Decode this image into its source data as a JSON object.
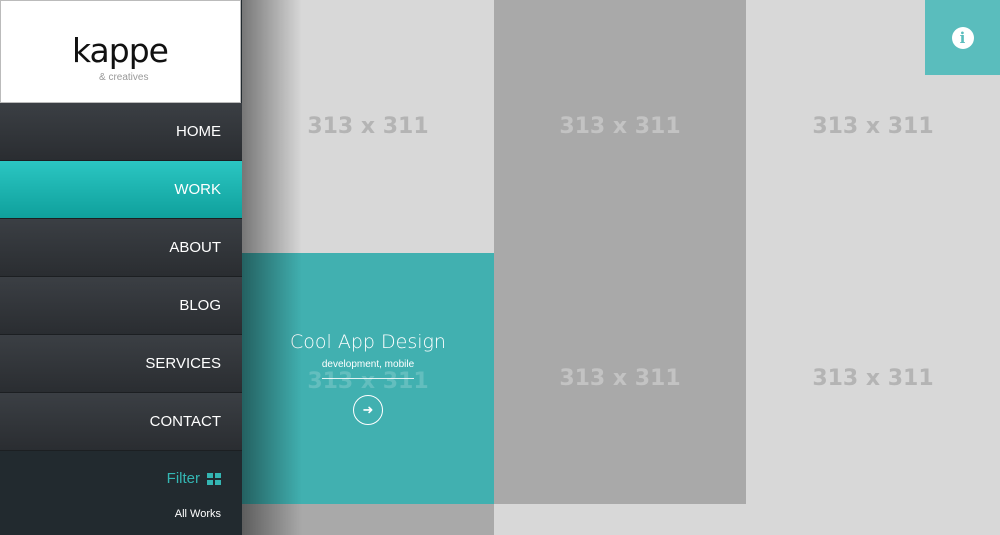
{
  "logo": {
    "name": "kappe",
    "tagline": "& creatives"
  },
  "nav": {
    "items": [
      {
        "label": "HOME"
      },
      {
        "label": "WORK"
      },
      {
        "label": "ABOUT"
      },
      {
        "label": "BLOG"
      },
      {
        "label": "SERVICES"
      },
      {
        "label": "CONTACT"
      }
    ],
    "active": "WORK"
  },
  "filter": {
    "label": "Filter",
    "icon": "grid-icon",
    "option": "All Works"
  },
  "tiles": [
    {
      "label": "313 x 311"
    },
    {
      "label": "313 x 311"
    },
    {
      "label": "313 x 311"
    },
    {
      "label": "313 x 311"
    },
    {
      "label": "313 x 311"
    },
    {
      "label": "313 x 311"
    }
  ],
  "featured": {
    "title": "Cool App Design",
    "tags": "development, mobile",
    "ghost_label": "313 x 311",
    "button_icon": "arrow-right-icon"
  },
  "info": {
    "icon": "info-icon",
    "glyph": "i"
  },
  "colors": {
    "accent": "#41b0b0",
    "sidebar": "#222a2f",
    "active_nav": "#1bb3af"
  }
}
